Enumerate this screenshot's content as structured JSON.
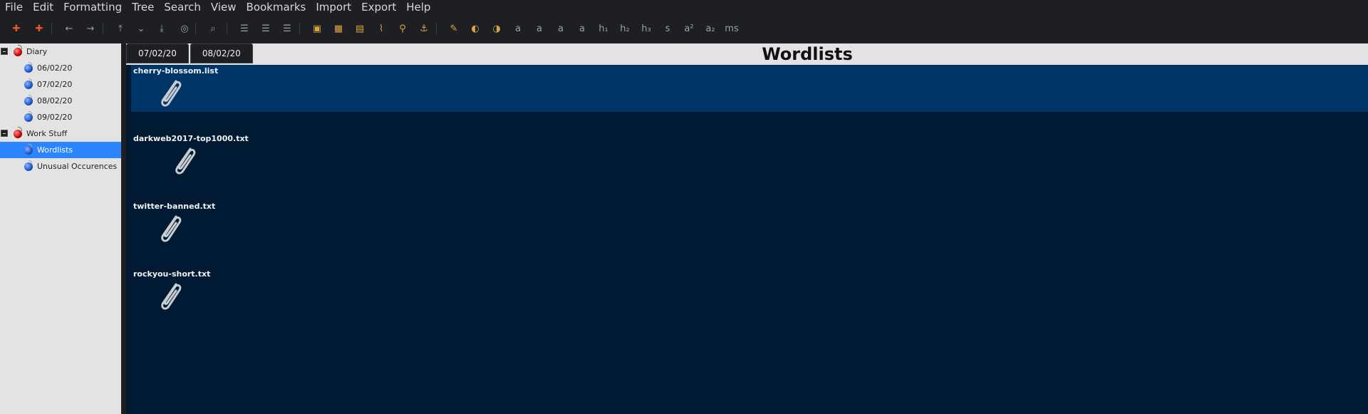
{
  "menubar": {
    "items": [
      "File",
      "Edit",
      "Formatting",
      "Tree",
      "Search",
      "View",
      "Bookmarks",
      "Import",
      "Export",
      "Help"
    ]
  },
  "toolbar": {
    "icons": [
      "add-node-icon",
      "add-subnode-icon",
      "go-back-icon",
      "go-forward-icon",
      "move-up-icon",
      "expand-icon",
      "move-down-icon",
      "export-pdf-icon",
      "find-icon",
      "bulleted-list-icon",
      "numbered-list-icon",
      "todo-list-icon",
      "insert-image-icon",
      "insert-table-icon",
      "insert-codebox-icon",
      "insert-file-icon",
      "insert-link-icon",
      "insert-anchor-icon",
      "clear-formatting-icon",
      "color-foreground-icon",
      "color-background-icon",
      "bold-icon",
      "italic-icon",
      "underline-icon",
      "strikethrough-icon",
      "h1-icon",
      "h2-icon",
      "h3-icon",
      "small-icon",
      "superscript-icon",
      "subscript-icon",
      "monospace-icon"
    ],
    "glyphs": [
      "✚",
      "✚",
      "←",
      "→",
      "⤒",
      "⌄",
      "⤓",
      "◎",
      "⌕",
      "☰",
      "☰",
      "☰",
      "▣",
      "▦",
      "▤",
      "⌇",
      "⚲",
      "⚓",
      "✎",
      "◐",
      "◑",
      "a",
      "a",
      "a",
      "a",
      "h₁",
      "h₂",
      "h₃",
      "s",
      "a²",
      "a₂",
      "ms"
    ]
  },
  "tree": {
    "items": [
      {
        "label": "Diary",
        "level": 0,
        "icon": "cherry",
        "expander": true
      },
      {
        "label": "06/02/20",
        "level": 1,
        "icon": "blue"
      },
      {
        "label": "07/02/20",
        "level": 1,
        "icon": "blue"
      },
      {
        "label": "08/02/20",
        "level": 1,
        "icon": "blue"
      },
      {
        "label": "09/02/20",
        "level": 1,
        "icon": "blue"
      },
      {
        "label": "Work Stuff",
        "level": 0,
        "icon": "cherry",
        "expander": true
      },
      {
        "label": "Wordlists",
        "level": 1,
        "icon": "blue",
        "selected": true
      },
      {
        "label": "Unusual Occurences",
        "level": 1,
        "icon": "blue"
      }
    ]
  },
  "tabs": [
    "07/02/20",
    "08/02/20"
  ],
  "page": {
    "title": "Wordlists"
  },
  "attachments": [
    {
      "name": "cherry-blossom.list",
      "selected": true
    },
    {
      "name": "darkweb2017-top1000.txt"
    },
    {
      "name": "twitter-banned.txt"
    },
    {
      "name": "rockyou-short.txt"
    }
  ],
  "colors": {
    "selected_tree_row": "#2c84ff",
    "editor_bg": "#001a33",
    "selected_attachment_bg": "#003568"
  }
}
